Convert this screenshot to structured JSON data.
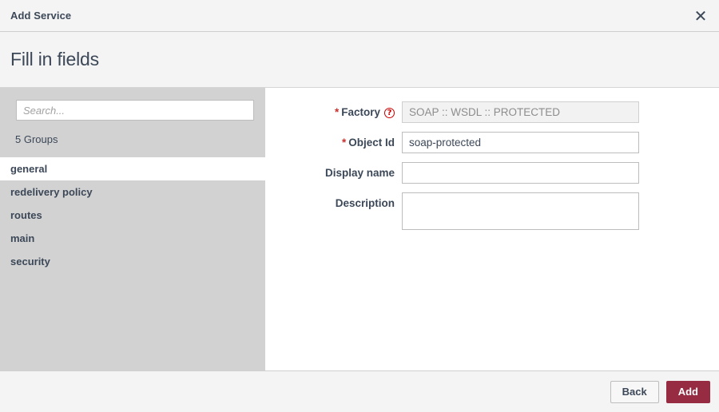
{
  "titlebar": {
    "title": "Add Service",
    "close_icon": "close-icon",
    "close_glyph": "✕"
  },
  "header": {
    "title": "Fill in fields"
  },
  "sidebar": {
    "search": {
      "placeholder": "Search...",
      "value": ""
    },
    "groups_count_label": "5 Groups",
    "items": [
      {
        "label": "general",
        "selected": true
      },
      {
        "label": "redelivery policy",
        "selected": false
      },
      {
        "label": "routes",
        "selected": false
      },
      {
        "label": "main",
        "selected": false
      },
      {
        "label": "security",
        "selected": false
      }
    ]
  },
  "form": {
    "fields": [
      {
        "label": "Factory",
        "required": true,
        "has_help_icon": true,
        "help_glyph": "?",
        "type": "text",
        "value": "SOAP :: WSDL :: PROTECTED",
        "placeholder": "",
        "disabled": true
      },
      {
        "label": "Object Id",
        "required": true,
        "has_help_icon": false,
        "type": "text",
        "value": "soap-protected",
        "placeholder": "",
        "disabled": false
      },
      {
        "label": "Display name",
        "required": false,
        "has_help_icon": false,
        "type": "text",
        "value": "",
        "placeholder": "",
        "disabled": false
      },
      {
        "label": "Description",
        "required": false,
        "has_help_icon": false,
        "type": "textarea",
        "value": "",
        "placeholder": "",
        "disabled": false
      }
    ],
    "required_marker": "*"
  },
  "footer": {
    "back_label": "Back",
    "add_label": "Add"
  },
  "colors": {
    "accent": "#962b41",
    "required": "#c9302c",
    "help_icon": "#cc0000",
    "sidebar_bg": "#d2d2d2",
    "chrome_bg": "#f4f4f4",
    "text": "#3c4858"
  }
}
